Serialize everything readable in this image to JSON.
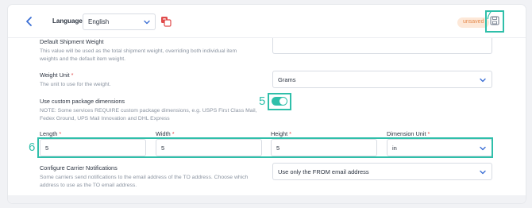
{
  "header": {
    "language_label": "Language",
    "language_value": "English",
    "unsaved_label": "unsaved",
    "annotation_save": "7"
  },
  "shipment_weight": {
    "label": "Default Shipment Weight",
    "help": [
      "This value will be used as the total shipment weight, overriding both individual item",
      "weights and the default item weight."
    ]
  },
  "weight_unit": {
    "label": "Weight Unit",
    "required": "*",
    "help": "The unit to use for the weight.",
    "value": "Grams"
  },
  "custom_dims": {
    "label": "Use custom package dimensions",
    "help": [
      "NOTE: Some services REQUIRE custom package dimensions, e.g. USPS First Class Mail,",
      "Fedex Ground, UPS Mail Innovation and DHL Express"
    ],
    "enabled": true,
    "annotation": "5"
  },
  "dimensions": {
    "annotation": "6",
    "length_label": "Length",
    "width_label": "Width",
    "height_label": "Height",
    "unit_label": "Dimension Unit",
    "required": "*",
    "length_value": "5",
    "width_value": "5",
    "height_value": "5",
    "unit_value": "in"
  },
  "carrier_notifications": {
    "label": "Configure Carrier Notifications",
    "help": [
      "Some carriers send notifications to the email address of the TO address. Choose which",
      "address to use as the TO email address."
    ],
    "value": "Use only the FROM email address"
  },
  "colors": {
    "accent": "#2fbfaa",
    "required": "#e04a4a",
    "unsaved_bg": "#fde8d8",
    "unsaved_text": "#e58a4c"
  }
}
